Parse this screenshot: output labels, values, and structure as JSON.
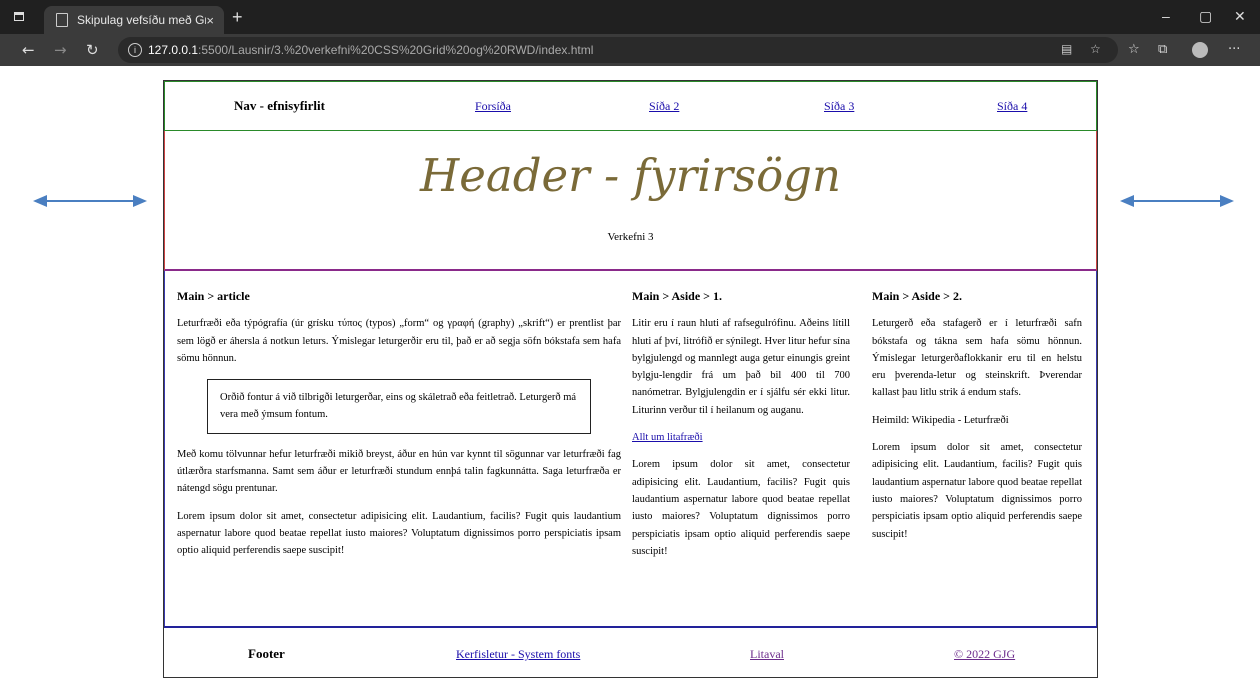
{
  "browser": {
    "tab_title": "Skipulag vefsíðu með Grid",
    "tab_close": "×",
    "new_tab": "+",
    "url_host": "127.0.0.1",
    "url_path": ":5500/Lausnir/3.%20verkefni%20CSS%20Grid%20og%20RWD/index.html",
    "window_controls": [
      "–",
      "▢",
      "✕"
    ]
  },
  "nav": {
    "brand": "Nav - efnisyfirlit",
    "links": [
      "Forsíða",
      "Síða 2",
      "Síða 3",
      "Síða 4"
    ]
  },
  "header": {
    "title": "Header - fyrirsögn",
    "subtitle": "Verkefni 3"
  },
  "article": {
    "heading": "Main > article",
    "p1": "Leturfræði eða týpógrafía (úr grísku τύπος (typos) „form“ og γραφή (graphy) „skrift“) er prentlist þar sem lögð er áhersla á notkun leturs. Ýmislegar leturgerðir eru til, það er að segja söfn bókstafa sem hafa sömu hönnun.",
    "quote": "Orðið fontur á við tilbrigði leturgerðar, eins og skáletrað eða feitletrað. Leturgerð má vera með ýmsum fontum.",
    "p2": "Með komu tölvunnar hefur leturfræði mikið breyst, áður en hún var kynnt til sögunnar var leturfræði fag útlærðra starfsmanna. Samt sem áður er leturfræði stundum ennþá talin fagkunnátta. Saga leturfræða er nátengd sögu prentunar.",
    "p3": "Lorem ipsum dolor sit amet, consectetur adipisicing elit. Laudantium, facilis? Fugit quis laudantium aspernatur labore quod beatae repellat iusto maiores? Voluptatum dignissimos porro perspiciatis ipsam optio aliquid perferendis saepe suscipit!"
  },
  "aside1": {
    "heading": "Main > Aside > 1.",
    "p1": "Litir eru í raun hluti af rafsegulrófinu. Aðeins lítill hluti af því, litrófið er sýnilegt. Hver litur hefur sína bylgjulengd og mannlegt auga getur einungis greint bylgju-lengdir frá um það bil 400 til 700 nanómetrar. Bylgjulengdin er í sjálfu sér ekki litur. Liturinn verður til í heilanum og auganu.",
    "link": "Allt um litafræði",
    "p2": "Lorem ipsum dolor sit amet, consectetur adipisicing elit. Laudantium, facilis? Fugit quis laudantium aspernatur labore quod beatae repellat iusto maiores? Voluptatum dignissimos porro perspiciatis ipsam optio aliquid perferendis saepe suscipit!"
  },
  "aside2": {
    "heading": "Main > Aside > 2.",
    "p1": "Leturgerð eða stafagerð er í leturfræði safn bókstafa og tákna sem hafa sömu hönnun. Ýmislegar leturgerðaflokkanir eru til en helstu eru þverenda-letur og steinskrift. Þverendar kallast þau litlu strik á endum stafs.",
    "source": "Heimild: Wikipedia - Leturfræði",
    "p2": "Lorem ipsum dolor sit amet, consectetur adipisicing elit. Laudantium, facilis? Fugit quis laudantium aspernatur labore quod beatae repellat iusto maiores? Voluptatum dignissimos porro perspiciatis ipsam optio aliquid perferendis saepe suscipit!"
  },
  "footer": {
    "brand": "Footer",
    "links": [
      "Kerfisletur - System fonts",
      "Litaval",
      "© 2022 GJG"
    ]
  },
  "colors": {
    "accent_arrow": "#4a7fc1",
    "header_title": "#7a6a38",
    "link": "#1a0dab",
    "visited_link": "#6b2b8b"
  }
}
